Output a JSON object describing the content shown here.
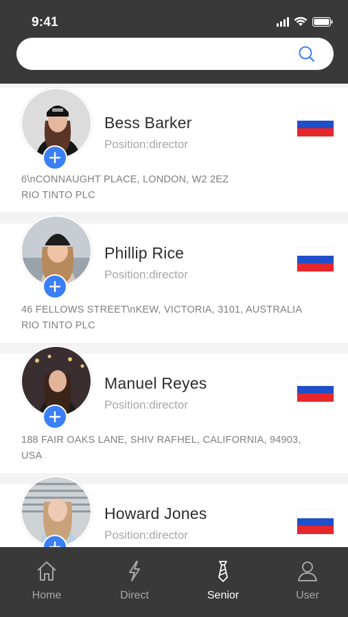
{
  "status_bar": {
    "time": "9:41"
  },
  "search": {
    "placeholder": "",
    "value": ""
  },
  "contacts": [
    {
      "name": "Bess Barker",
      "position": "Position:director",
      "address_line1": "6\\nCONNAUGHT PLACE, LONDON, W2 2EZ",
      "address_line2": "RIO TINTO PLC",
      "flag": "russia-flag-icon"
    },
    {
      "name": "Phillip Rice",
      "position": "Position:director",
      "address_line1": "46 FELLOWS STREET\\nKEW, VICTORIA, 3101, AUSTRALIA",
      "address_line2": "RIO TINTO PLC",
      "flag": "russia-flag-icon"
    },
    {
      "name": "Manuel Reyes",
      "position": "Position:director",
      "address_line1": "188 FAIR OAKS LANE, SHIV RAFHEL, CALIFORNIA, 94903,",
      "address_line2": "USA",
      "flag": "russia-flag-icon"
    },
    {
      "name": "Howard Jones",
      "position": "Position:director",
      "address_line1": "",
      "address_line2": "",
      "flag": "russia-flag-icon"
    }
  ],
  "tabs": [
    {
      "label": "Home",
      "icon": "home-icon",
      "active": false
    },
    {
      "label": "Direct",
      "icon": "lightning-icon",
      "active": false
    },
    {
      "label": "Senior",
      "icon": "tie-icon",
      "active": true
    },
    {
      "label": "User",
      "icon": "user-icon",
      "active": false
    }
  ],
  "colors": {
    "header_bg": "#393939",
    "accent_blue": "#3a7ff6",
    "flag_white": "#ffffff",
    "flag_blue": "#1f4fc9",
    "flag_red": "#e5262b",
    "active_tab": "#ffffff",
    "inactive_tab": "#a7a7a7"
  }
}
